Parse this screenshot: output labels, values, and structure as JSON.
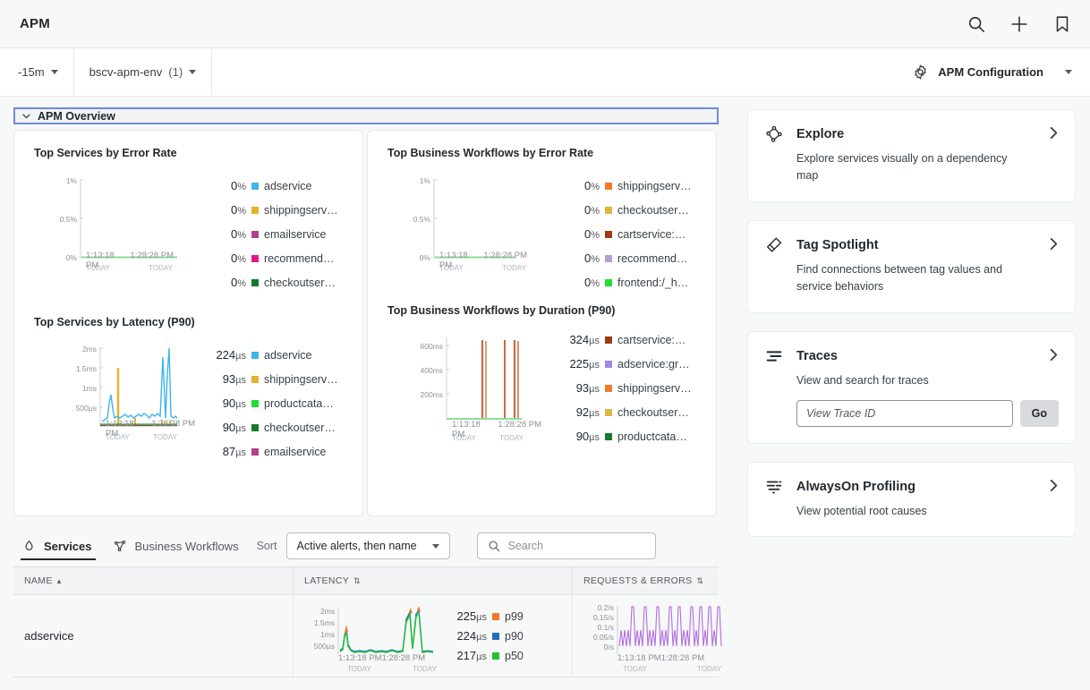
{
  "header": {
    "app_title": "APM",
    "icons": [
      "search-icon",
      "plus-icon",
      "bookmark-icon"
    ]
  },
  "filterbar": {
    "time_range": "-15m",
    "environment": "bscv-apm-env",
    "environment_count": "(1)",
    "config_label": "APM Configuration"
  },
  "overview": {
    "banner_label": "APM Overview",
    "banner_border_color": "#6c8cd5"
  },
  "chart_data": [
    {
      "type": "line",
      "title": "Top Services by Error Rate",
      "ylabel": "",
      "xlabel": "",
      "ylim": [
        0,
        1
      ],
      "yticks": [
        "0%",
        "0.5%",
        "1%"
      ],
      "xticks": [
        "1:13:18 PM",
        "1:28:28 PM"
      ],
      "xtick_days": [
        "TODAY",
        "TODAY"
      ],
      "legend_position": "right",
      "series": [
        {
          "name": "adservice",
          "value": "0",
          "unit": "%",
          "color": "#3fb5e8",
          "values": [
            0,
            0,
            0,
            0,
            0,
            0,
            0,
            0,
            0,
            0,
            0,
            0
          ]
        },
        {
          "name": "shippingserv…",
          "value": "0",
          "unit": "%",
          "color": "#e5b32e",
          "values": [
            0,
            0,
            0,
            0,
            0,
            0,
            0,
            0,
            0,
            0,
            0,
            0
          ]
        },
        {
          "name": "emailservice",
          "value": "0",
          "unit": "%",
          "color": "#b03f8c",
          "values": [
            0,
            0,
            0,
            0,
            0,
            0,
            0,
            0,
            0,
            0,
            0,
            0
          ]
        },
        {
          "name": "recommend…",
          "value": "0",
          "unit": "%",
          "color": "#e6188c",
          "values": [
            0,
            0,
            0,
            0,
            0,
            0,
            0,
            0,
            0,
            0,
            0,
            0
          ]
        },
        {
          "name": "checkoutser…",
          "value": "0",
          "unit": "%",
          "color": "#157a2e",
          "values": [
            0,
            0,
            0,
            0,
            0,
            0,
            0,
            0,
            0,
            0,
            0,
            0
          ]
        }
      ]
    },
    {
      "type": "line",
      "title": "Top Business Workflows by Error Rate",
      "ylim": [
        0,
        1
      ],
      "yticks": [
        "0%",
        "0.5%",
        "1%"
      ],
      "xticks": [
        "1:13:18 PM",
        "1:28:28 PM"
      ],
      "xtick_days": [
        "TODAY",
        "TODAY"
      ],
      "legend_position": "right",
      "series": [
        {
          "name": "shippingserv…",
          "value": "0",
          "unit": "%",
          "color": "#f07a28",
          "values": [
            0,
            0,
            0,
            0,
            0,
            0,
            0,
            0,
            0,
            0,
            0,
            0
          ]
        },
        {
          "name": "checkoutser…",
          "value": "0",
          "unit": "%",
          "color": "#ddb742",
          "values": [
            0,
            0,
            0,
            0,
            0,
            0,
            0,
            0,
            0,
            0,
            0,
            0
          ]
        },
        {
          "name": "cartservice:…",
          "value": "0",
          "unit": "%",
          "color": "#9e3a11",
          "values": [
            0,
            0,
            0,
            0,
            0,
            0,
            0,
            0,
            0,
            0,
            0,
            0
          ]
        },
        {
          "name": "recommend…",
          "value": "0",
          "unit": "%",
          "color": "#b3a0cc",
          "values": [
            0,
            0,
            0,
            0,
            0,
            0,
            0,
            0,
            0,
            0,
            0,
            0
          ]
        },
        {
          "name": "frontend:/_h…",
          "value": "0",
          "unit": "%",
          "color": "#22dd33",
          "values": [
            0,
            0,
            0,
            0,
            0,
            0,
            0,
            0,
            0,
            0,
            0,
            0
          ]
        }
      ]
    },
    {
      "type": "line",
      "title": "Top Services by Latency (P90)",
      "ylim": [
        0,
        2
      ],
      "yticks": [
        "500µs",
        "1ms",
        "1.5ms",
        "2ms"
      ],
      "xticks": [
        "1:13:18 PM",
        "1:28:28 PM"
      ],
      "xtick_days": [
        "TODAY",
        "TODAY"
      ],
      "legend_position": "right",
      "series": [
        {
          "name": "adservice",
          "value": "224",
          "unit": "µs",
          "color": "#3fb5e8"
        },
        {
          "name": "shippingserv…",
          "value": "93",
          "unit": "µs",
          "color": "#e5b32e"
        },
        {
          "name": "productcata…",
          "value": "90",
          "unit": "µs",
          "color": "#22dd33"
        },
        {
          "name": "checkoutser…",
          "value": "90",
          "unit": "µs",
          "color": "#157a2e"
        },
        {
          "name": "emailservice",
          "value": "87",
          "unit": "µs",
          "color": "#b03f8c"
        }
      ]
    },
    {
      "type": "line",
      "title": "Top Business Workflows by Duration (P90)",
      "ylim": [
        0,
        700
      ],
      "yticks": [
        "200ms",
        "400ms",
        "600ms"
      ],
      "xticks": [
        "1:13:18 PM",
        "1:28:28 PM"
      ],
      "xtick_days": [
        "TODAY",
        "TODAY"
      ],
      "legend_position": "right",
      "series": [
        {
          "name": "cartservice:…",
          "value": "324",
          "unit": "µs",
          "color": "#9e3a11"
        },
        {
          "name": "adservice:gr…",
          "value": "225",
          "unit": "µs",
          "color": "#9d8ae0"
        },
        {
          "name": "shippingserv…",
          "value": "93",
          "unit": "µs",
          "color": "#f07a28"
        },
        {
          "name": "checkoutser…",
          "value": "92",
          "unit": "µs",
          "color": "#ddb742"
        },
        {
          "name": "productcata…",
          "value": "90",
          "unit": "µs",
          "color": "#157a2e"
        }
      ]
    }
  ],
  "tabs": [
    {
      "label": "Services",
      "icon": "service-icon",
      "active": true
    },
    {
      "label": "Business Workflows",
      "icon": "workflow-icon",
      "active": false
    }
  ],
  "sort": {
    "label": "Sort",
    "selected": "Active alerts, then name"
  },
  "search": {
    "placeholder": "Search",
    "value": ""
  },
  "table": {
    "columns": [
      {
        "label": "NAME",
        "sort": "▴"
      },
      {
        "label": "LATENCY",
        "sort": "⇅"
      },
      {
        "label": "REQUESTS & ERRORS",
        "sort": "⇅"
      }
    ],
    "rows": [
      {
        "name": "adservice",
        "latency_chart": {
          "yticks": [
            "500µs",
            "1ms",
            "1.5ms",
            "2ms"
          ],
          "xticks": [
            "1:13:18 PM",
            "1:28:28 PM"
          ],
          "xtick_days": [
            "TODAY",
            "TODAY"
          ]
        },
        "latency_legend": [
          {
            "value": "225",
            "unit": "µs",
            "name": "p99",
            "color": "#f07a28"
          },
          {
            "value": "224",
            "unit": "µs",
            "name": "p90",
            "color": "#1d6fbd"
          },
          {
            "value": "217",
            "unit": "µs",
            "name": "p50",
            "color": "#22c032"
          }
        ],
        "requests_chart": {
          "yticks": [
            "0/s",
            "0.05/s",
            "0.1/s",
            "0.15/s",
            "0.2/s"
          ],
          "xticks": [
            "1:13:18 PM",
            "1:28:28 PM"
          ],
          "xtick_days": [
            "TODAY",
            "TODAY"
          ],
          "color": "#b36ce0"
        }
      }
    ]
  },
  "right_cards": [
    {
      "icon": "dependency-map-icon",
      "title": "Explore",
      "desc": "Explore services visually on a dependency map"
    },
    {
      "icon": "spotlight-icon",
      "title": "Tag Spotlight",
      "desc": "Find connections between tag values and service behaviors"
    },
    {
      "icon": "traces-icon",
      "title": "Traces",
      "desc": "View and search for traces",
      "trace_placeholder": "View Trace ID",
      "trace_value": "",
      "go_label": "Go"
    },
    {
      "icon": "profiling-icon",
      "title": "AlwaysOn Profiling",
      "desc": "View potential root causes"
    }
  ]
}
